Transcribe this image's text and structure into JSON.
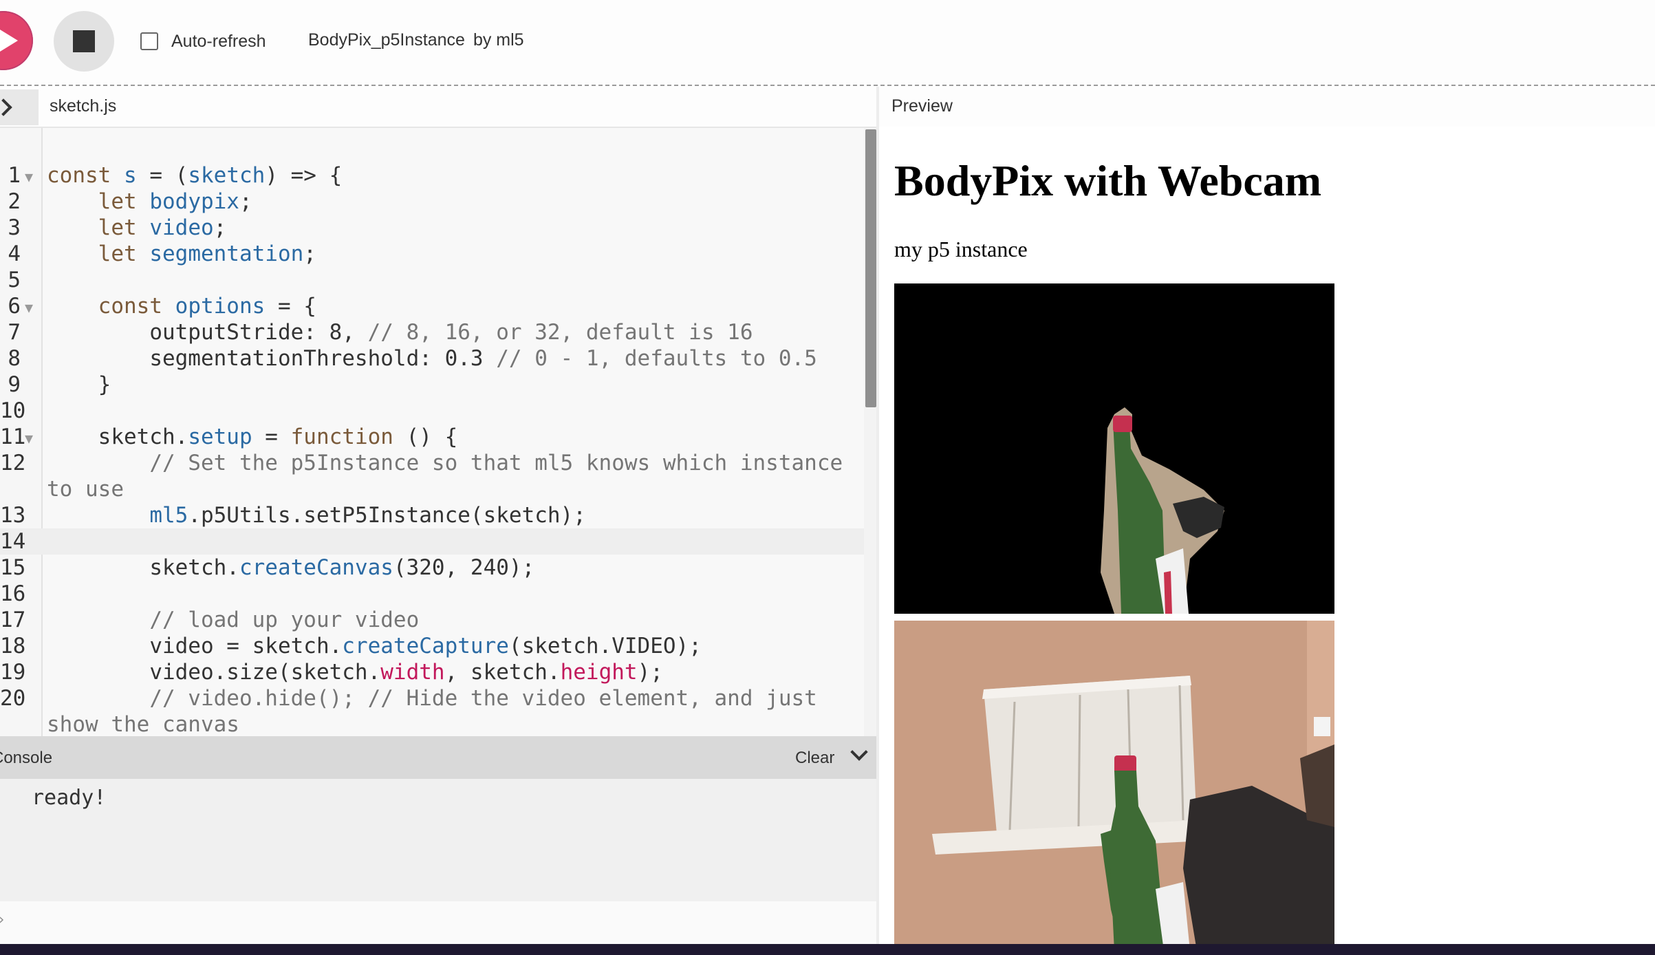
{
  "toolbar": {
    "auto_refresh_label": "Auto-refresh",
    "auto_refresh_checked": false,
    "sketch_name": "BodyPix_p5Instance",
    "author": "by ml5"
  },
  "editor": {
    "file_tab": "sketch.js",
    "active_line": 14,
    "lines": [
      "const s = (sketch) => {",
      "    let bodypix;",
      "    let video;",
      "    let segmentation;",
      "",
      "    const options = {",
      "        outputStride: 8, // 8, 16, or 32, default is 16",
      "        segmentationThreshold: 0.3 // 0 - 1, defaults to 0.5",
      "    }",
      "",
      "    sketch.setup = function () {",
      "        // Set the p5Instance so that ml5 knows which instance to use",
      "        ml5.p5Utils.setP5Instance(sketch);",
      "",
      "        sketch.createCanvas(320, 240);",
      "",
      "        // load up your video",
      "        video = sketch.createCapture(sketch.VIDEO);",
      "        video.size(sketch.width, sketch.height);",
      "        // video.hide(); // Hide the video element, and just show the canvas"
    ]
  },
  "console": {
    "title": "Console",
    "clear_label": "Clear",
    "messages": [
      "ready!"
    ]
  },
  "preview": {
    "label": "Preview",
    "heading": "BodyPix with Webcam",
    "subtitle": "my p5 instance"
  },
  "colors": {
    "play": "#e1426b",
    "keyword": "#7a5a3a",
    "variable": "#2b6aa3",
    "property": "#c2185b",
    "comment": "#757575"
  }
}
